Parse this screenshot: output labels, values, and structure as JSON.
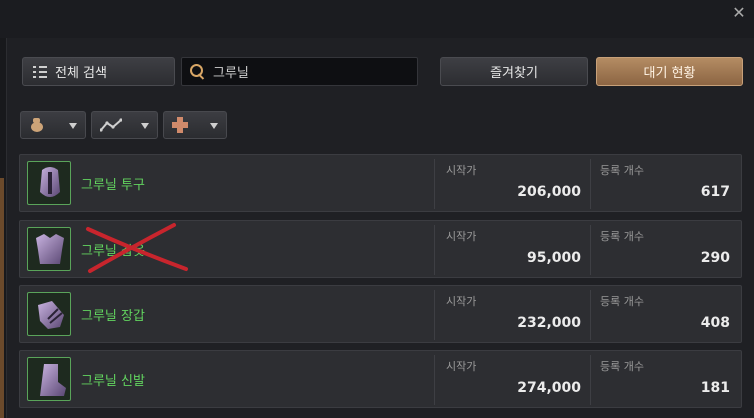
{
  "window": {
    "close_symbol": "✕"
  },
  "toolbar": {
    "all_search_label": "전체 검색",
    "search_value": "그루닐",
    "favorites_label": "즐겨찾기",
    "waiting_status_label": "대기 현황"
  },
  "filters": [
    {
      "icon": "money-bag-icon"
    },
    {
      "icon": "price-trend-icon"
    },
    {
      "icon": "plus-cross-icon"
    }
  ],
  "columns": {
    "start_price": "시작가",
    "registered_count": "등록 개수"
  },
  "items": [
    {
      "name": "그루닐 투구",
      "start_price": "206,000",
      "count": "617",
      "crossed_out": false
    },
    {
      "name": "그루닐 갑옷",
      "start_price": "95,000",
      "count": "290",
      "crossed_out": true
    },
    {
      "name": "그루닐 장갑",
      "start_price": "232,000",
      "count": "408",
      "crossed_out": false
    },
    {
      "name": "그루닐 신발",
      "start_price": "274,000",
      "count": "181",
      "crossed_out": false
    }
  ],
  "colors": {
    "item_name": "#62d45f",
    "accent_button": "#a37a53",
    "search_icon": "#d9a766",
    "scribble": "#c8252d"
  }
}
